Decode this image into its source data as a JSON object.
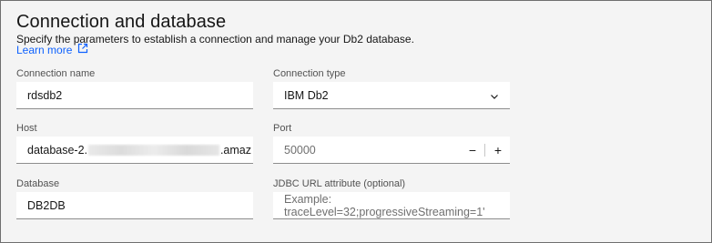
{
  "section": {
    "title": "Connection and database",
    "description": "Specify the parameters to establish a connection and manage your Db2 database.",
    "learn_more": "Learn more",
    "learn_more_icon": "external-link-icon"
  },
  "fields": {
    "connection_name": {
      "label": "Connection name",
      "value": "rdsdb2"
    },
    "connection_type": {
      "label": "Connection type",
      "value": "IBM Db2",
      "icon": "chevron-down-icon"
    },
    "host": {
      "label": "Host",
      "value_prefix": "database-2.",
      "value_suffix": ".amaz"
    },
    "port": {
      "label": "Port",
      "value": "50000",
      "decrement": "−",
      "increment": "+"
    },
    "database": {
      "label": "Database",
      "value": "DB2DB"
    },
    "jdbc": {
      "label": "JDBC URL attribute (optional)",
      "placeholder": "Example: traceLevel=32;progressiveStreaming=1'"
    }
  },
  "colors": {
    "accent_link": "#0f62fe",
    "panel_bg": "#f4f4f4",
    "field_bg": "#ffffff"
  }
}
